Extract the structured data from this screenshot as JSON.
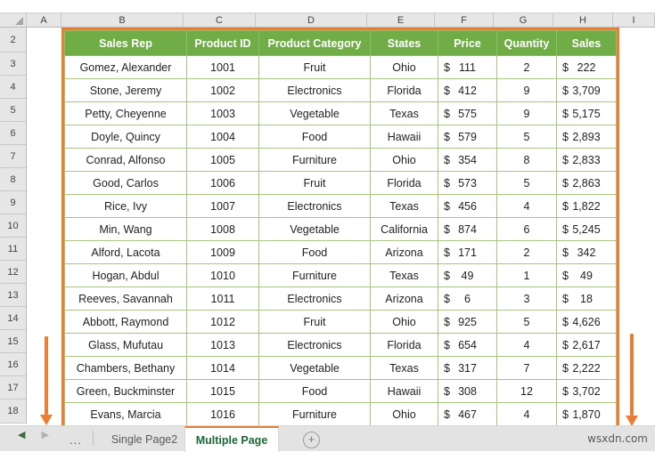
{
  "spreadsheet": {
    "column_letters": [
      "A",
      "B",
      "C",
      "D",
      "E",
      "F",
      "G",
      "H",
      "I"
    ],
    "row_numbers": [
      "2",
      "3",
      "4",
      "5",
      "6",
      "7",
      "8",
      "9",
      "10",
      "11",
      "12",
      "13",
      "14",
      "15",
      "16",
      "17",
      "18"
    ],
    "headers": [
      "Sales Rep",
      "Product ID",
      "Product Category",
      "States",
      "Price",
      "Quantity",
      "Sales"
    ],
    "currency_symbol": "$",
    "rows": [
      {
        "rep": "Gomez, Alexander",
        "pid": "1001",
        "cat": "Fruit",
        "state": "Ohio",
        "price": "111",
        "qty": "2",
        "sales": "222"
      },
      {
        "rep": "Stone, Jeremy",
        "pid": "1002",
        "cat": "Electronics",
        "state": "Florida",
        "price": "412",
        "qty": "9",
        "sales": "3,709"
      },
      {
        "rep": "Petty, Cheyenne",
        "pid": "1003",
        "cat": "Vegetable",
        "state": "Texas",
        "price": "575",
        "qty": "9",
        "sales": "5,175"
      },
      {
        "rep": "Doyle, Quincy",
        "pid": "1004",
        "cat": "Food",
        "state": "Hawaii",
        "price": "579",
        "qty": "5",
        "sales": "2,893"
      },
      {
        "rep": "Conrad, Alfonso",
        "pid": "1005",
        "cat": "Furniture",
        "state": "Ohio",
        "price": "354",
        "qty": "8",
        "sales": "2,833"
      },
      {
        "rep": "Good, Carlos",
        "pid": "1006",
        "cat": "Fruit",
        "state": "Florida",
        "price": "573",
        "qty": "5",
        "sales": "2,863"
      },
      {
        "rep": "Rice, Ivy",
        "pid": "1007",
        "cat": "Electronics",
        "state": "Texas",
        "price": "456",
        "qty": "4",
        "sales": "1,822"
      },
      {
        "rep": "Min, Wang",
        "pid": "1008",
        "cat": "Vegetable",
        "state": "California",
        "price": "874",
        "qty": "6",
        "sales": "5,245"
      },
      {
        "rep": "Alford, Lacota",
        "pid": "1009",
        "cat": "Food",
        "state": "Arizona",
        "price": "171",
        "qty": "2",
        "sales": "342"
      },
      {
        "rep": "Hogan, Abdul",
        "pid": "1010",
        "cat": "Furniture",
        "state": "Texas",
        "price": "49",
        "qty": "1",
        "sales": "49"
      },
      {
        "rep": "Reeves, Savannah",
        "pid": "1011",
        "cat": "Electronics",
        "state": "Arizona",
        "price": "6",
        "qty": "3",
        "sales": "18"
      },
      {
        "rep": "Abbott, Raymond",
        "pid": "1012",
        "cat": "Fruit",
        "state": "Ohio",
        "price": "925",
        "qty": "5",
        "sales": "4,626"
      },
      {
        "rep": "Glass, Mufutau",
        "pid": "1013",
        "cat": "Electronics",
        "state": "Florida",
        "price": "654",
        "qty": "4",
        "sales": "2,617"
      },
      {
        "rep": "Chambers, Bethany",
        "pid": "1014",
        "cat": "Vegetable",
        "state": "Texas",
        "price": "317",
        "qty": "7",
        "sales": "2,222"
      },
      {
        "rep": "Green, Buckminster",
        "pid": "1015",
        "cat": "Food",
        "state": "Hawaii",
        "price": "308",
        "qty": "12",
        "sales": "3,702"
      },
      {
        "rep": "Evans, Marcia",
        "pid": "1016",
        "cat": "Furniture",
        "state": "Ohio",
        "price": "467",
        "qty": "4",
        "sales": "1,870"
      }
    ]
  },
  "annotations": {
    "accent_color": "#ed7d31",
    "header_fill": "#70ad47",
    "left_arrow": "down-arrow-left",
    "right_arrow": "down-arrow-right"
  },
  "sheet_tabs": {
    "prev_label": "◀",
    "next_label": "▶",
    "overflow_label": "...",
    "tabs": [
      {
        "label": "Single Page2",
        "active": false
      },
      {
        "label": "Multiple Page",
        "active": true
      }
    ],
    "add_label": "+"
  },
  "watermark": {
    "text": "wsxdn.com"
  }
}
